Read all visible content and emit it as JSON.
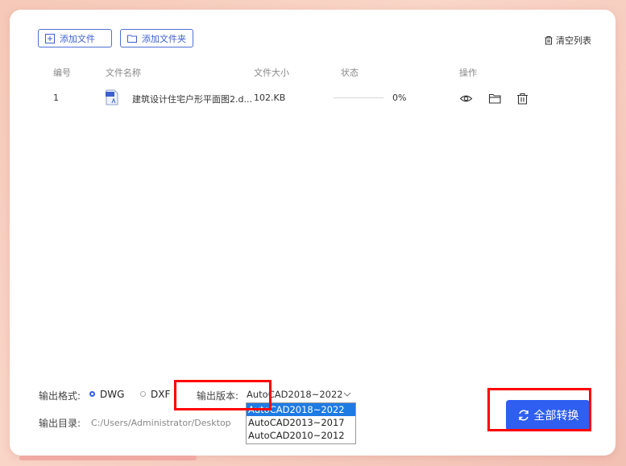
{
  "toolbar": {
    "add_file_label": "添加文件",
    "add_folder_label": "添加文件夹",
    "clear_list_label": "清空列表"
  },
  "table": {
    "headers": [
      "编号",
      "文件名称",
      "文件大小",
      "状态",
      "操作"
    ],
    "rows": [
      {
        "index": "1",
        "file_icon": "dwg-file-icon",
        "file_name": "建筑设计住宅户形平面图2.d...",
        "file_size": "102.KB",
        "progress_text": "0%",
        "progress_value": 0,
        "actions": [
          "eye-icon",
          "folder-icon",
          "trash-icon"
        ]
      }
    ]
  },
  "output": {
    "format_label": "输出格式:",
    "format_options": [
      "DWG",
      "DXF"
    ],
    "format_selected": "DWG",
    "version_label": "输出版本:",
    "version_selected": "AutoCAD2018~2022",
    "version_options": [
      "AutoCAD2018~2022",
      "AutoCAD2013~2017",
      "AutoCAD2010~2012"
    ],
    "dir_label": "输出目录:",
    "dir_path": "C:/Users/Administrator/Desktop"
  },
  "convert_all_label": "全部转换",
  "colors": {
    "accent": "#2e5ff0",
    "highlight_box": "#ff0000",
    "selected_option": "#1e7be3"
  }
}
